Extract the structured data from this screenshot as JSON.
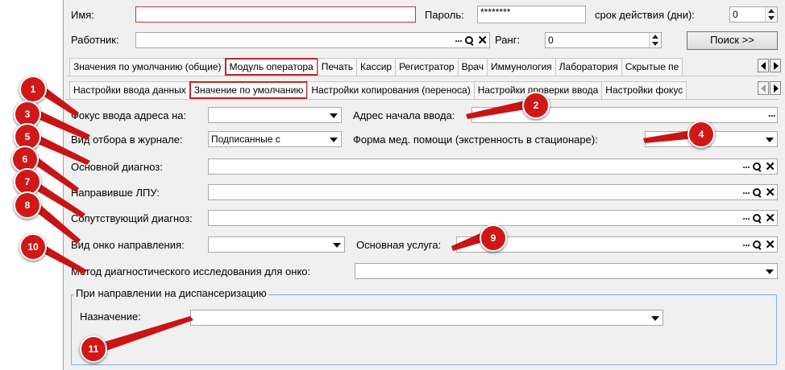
{
  "header": {
    "name_label": "Имя:",
    "name_value": "",
    "password_label": "Пароль:",
    "password_value": "********",
    "validity_label": "срок действия (дни):",
    "validity_value": "0",
    "worker_label": "Работник:",
    "worker_value": "",
    "rank_label": "Ранг:",
    "rank_value": "0",
    "search_button": "Поиск >>"
  },
  "main_tabs": [
    {
      "label": "Значения по умолчанию (общие)",
      "active": false
    },
    {
      "label": "Модуль оператора",
      "active": true
    },
    {
      "label": "Печать",
      "active": false
    },
    {
      "label": "Кассир",
      "active": false
    },
    {
      "label": "Регистратор",
      "active": false
    },
    {
      "label": "Врач",
      "active": false
    },
    {
      "label": "Иммунология",
      "active": false
    },
    {
      "label": "Лаборатория",
      "active": false
    },
    {
      "label": "Скрытые пе",
      "active": false
    }
  ],
  "sub_tabs": [
    {
      "label": "Настройки ввода данных",
      "active": false
    },
    {
      "label": "Значение по умолчанию",
      "active": true
    },
    {
      "label": "Настройки копирования (переноса)",
      "active": false
    },
    {
      "label": "Настройки проверки ввода",
      "active": false
    },
    {
      "label": "Настройки фокус",
      "active": false
    }
  ],
  "form": {
    "focus_label": "Фокус ввода адреса на:",
    "focus_value": "",
    "address_start_label": "Адрес начала ввода:",
    "address_start_value": "",
    "journal_label": "Вид отбора в журнале:",
    "journal_value": "Подписанные с",
    "care_form_label": "Форма мед. помощи (экстренность в стационаре):",
    "care_form_value": "",
    "main_diag_label": "Основной диагноз:",
    "main_diag_value": "",
    "ref_lpu_label": "Направивше ЛПУ:",
    "ref_lpu_value": "",
    "co_diag_label": "Сопутствующий диагноз:",
    "co_diag_value": "",
    "onco_label": "Вид онко направления:",
    "onco_value": "",
    "service_label": "Основная услуга:",
    "service_value": "",
    "method_label": "Метод диагностического исследования для онко:",
    "method_value": ""
  },
  "group": {
    "title": "При направлении на диспансеризацию",
    "purpose_label": "Назначение:",
    "purpose_value": ""
  },
  "badges": [
    "1",
    "2",
    "3",
    "4",
    "5",
    "6",
    "7",
    "8",
    "9",
    "10",
    "11"
  ],
  "tools": {
    "dots": "···",
    "close": "✕"
  },
  "colors": {
    "accent_red": "#d01818",
    "group_border": "#7fb0df",
    "panel_bg": "#f0f0f0"
  }
}
